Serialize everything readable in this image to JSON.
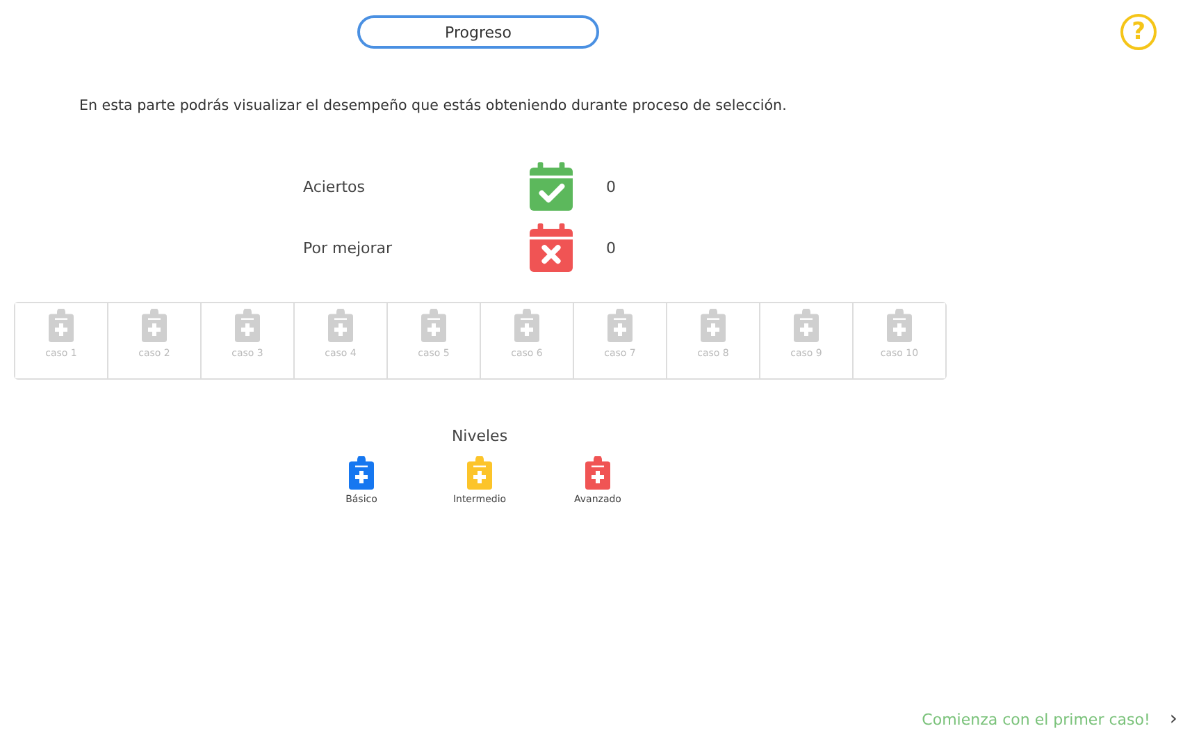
{
  "header": {
    "title": "Progreso",
    "help": "?"
  },
  "intro": "En esta parte podrás visualizar el desempeño que estás obteniendo durante proceso de selección.",
  "stats": [
    {
      "label": "Aciertos",
      "kind": "correct",
      "color": "#5cb85c",
      "value": "0"
    },
    {
      "label": "Por mejorar",
      "kind": "wrong",
      "color": "#f05454",
      "value": "0"
    }
  ],
  "cases": [
    {
      "label": "caso 1"
    },
    {
      "label": "caso 2"
    },
    {
      "label": "caso 3"
    },
    {
      "label": "caso 4"
    },
    {
      "label": "caso 5"
    },
    {
      "label": "caso 6"
    },
    {
      "label": "caso 7"
    },
    {
      "label": "caso 8"
    },
    {
      "label": "caso 9"
    },
    {
      "label": "caso 10"
    }
  ],
  "levels": {
    "title": "Niveles",
    "items": [
      {
        "label": "Básico",
        "color": "#1677f0"
      },
      {
        "label": "Intermedio",
        "color": "#fcc42a"
      },
      {
        "label": "Avanzado",
        "color": "#f05454"
      }
    ]
  },
  "footer": {
    "link": "Comienza con el primer caso!",
    "arrow": "›"
  }
}
